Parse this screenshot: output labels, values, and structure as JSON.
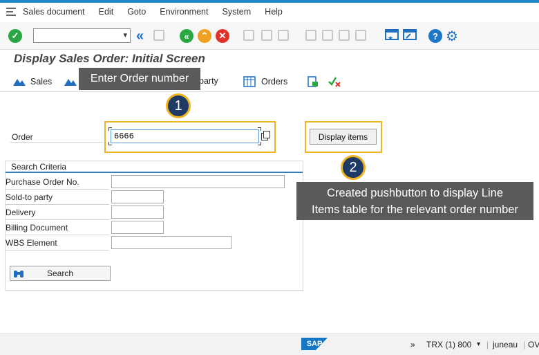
{
  "menubar": {
    "items": [
      "Sales document",
      "Edit",
      "Goto",
      "Environment",
      "System",
      "Help"
    ]
  },
  "title": "Display Sales Order: Initial Screen",
  "apptoolbar": {
    "sales_label": "Sales",
    "party_label": "party",
    "orders_label": "Orders"
  },
  "callouts": {
    "enter_order": "Enter Order number",
    "badge1": "1",
    "badge2": "2",
    "pushbutton_desc_line1": "Created pushbutton to display Line",
    "pushbutton_desc_line2": "Items table for the relevant order number"
  },
  "order": {
    "label": "Order",
    "value": "6666"
  },
  "display_items_label": "Display items",
  "search_criteria": {
    "title": "Search Criteria",
    "rows": [
      "Purchase Order No.",
      "Sold-to party",
      "Delivery",
      "Billing Document",
      "WBS Element"
    ],
    "search_label": "Search"
  },
  "statusbar": {
    "logo": "SAP",
    "chevrons": "»",
    "system": "TRX (1) 800",
    "user": "juneau",
    "mode": "OV"
  },
  "colors": {
    "accent": "#1e88c8",
    "highlight": "#f0b323",
    "badge": "#1f3a64",
    "callout": "#5a5a5a"
  }
}
